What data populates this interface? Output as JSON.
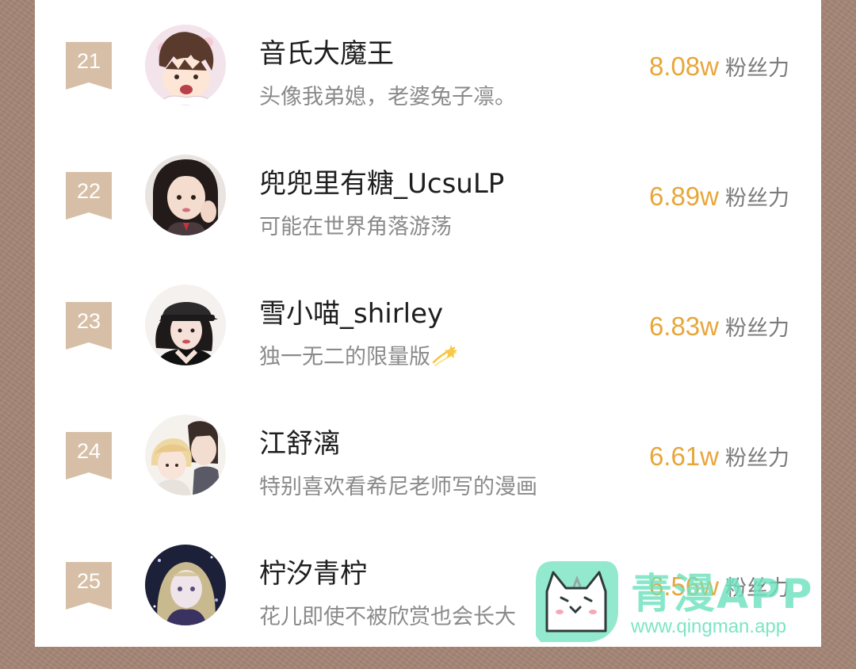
{
  "ranking": {
    "items": [
      {
        "rank": "21",
        "username": "音氏大魔王",
        "bio": "头像我弟媳，老婆兔子凛。",
        "fans": "8.08w",
        "fans_label": "粉丝力",
        "avatar": "avatar-cartoon-boy"
      },
      {
        "rank": "22",
        "username": "兜兜里有糖_UcsuLP",
        "bio": "可能在世界角落游荡",
        "fans": "6.89w",
        "fans_label": "粉丝力",
        "avatar": "avatar-girl-selfie"
      },
      {
        "rank": "23",
        "username": "雪小喵_shirley",
        "bio": "独一无二的限量版",
        "bio_icon": "dizzy-star-icon",
        "fans": "6.83w",
        "fans_label": "粉丝力",
        "avatar": "avatar-girl-cap"
      },
      {
        "rank": "24",
        "username": "江舒漓",
        "bio": "特别喜欢看希尼老师写的漫画",
        "fans": "6.61w",
        "fans_label": "粉丝力",
        "avatar": "avatar-comic-couple"
      },
      {
        "rank": "25",
        "username": "柠汐青柠",
        "bio": "花儿即使不被欣赏也会长大",
        "fans": "6.56w",
        "fans_label": "粉丝力",
        "avatar": "avatar-anime-girl"
      }
    ]
  },
  "watermark": {
    "title": "青漫APP",
    "url": "www.qingman.app",
    "icon": "cat-icon"
  },
  "colors": {
    "badge": "#d6bfa6",
    "fans_value": "#e8a63a",
    "watermark": "#6ee2be"
  }
}
